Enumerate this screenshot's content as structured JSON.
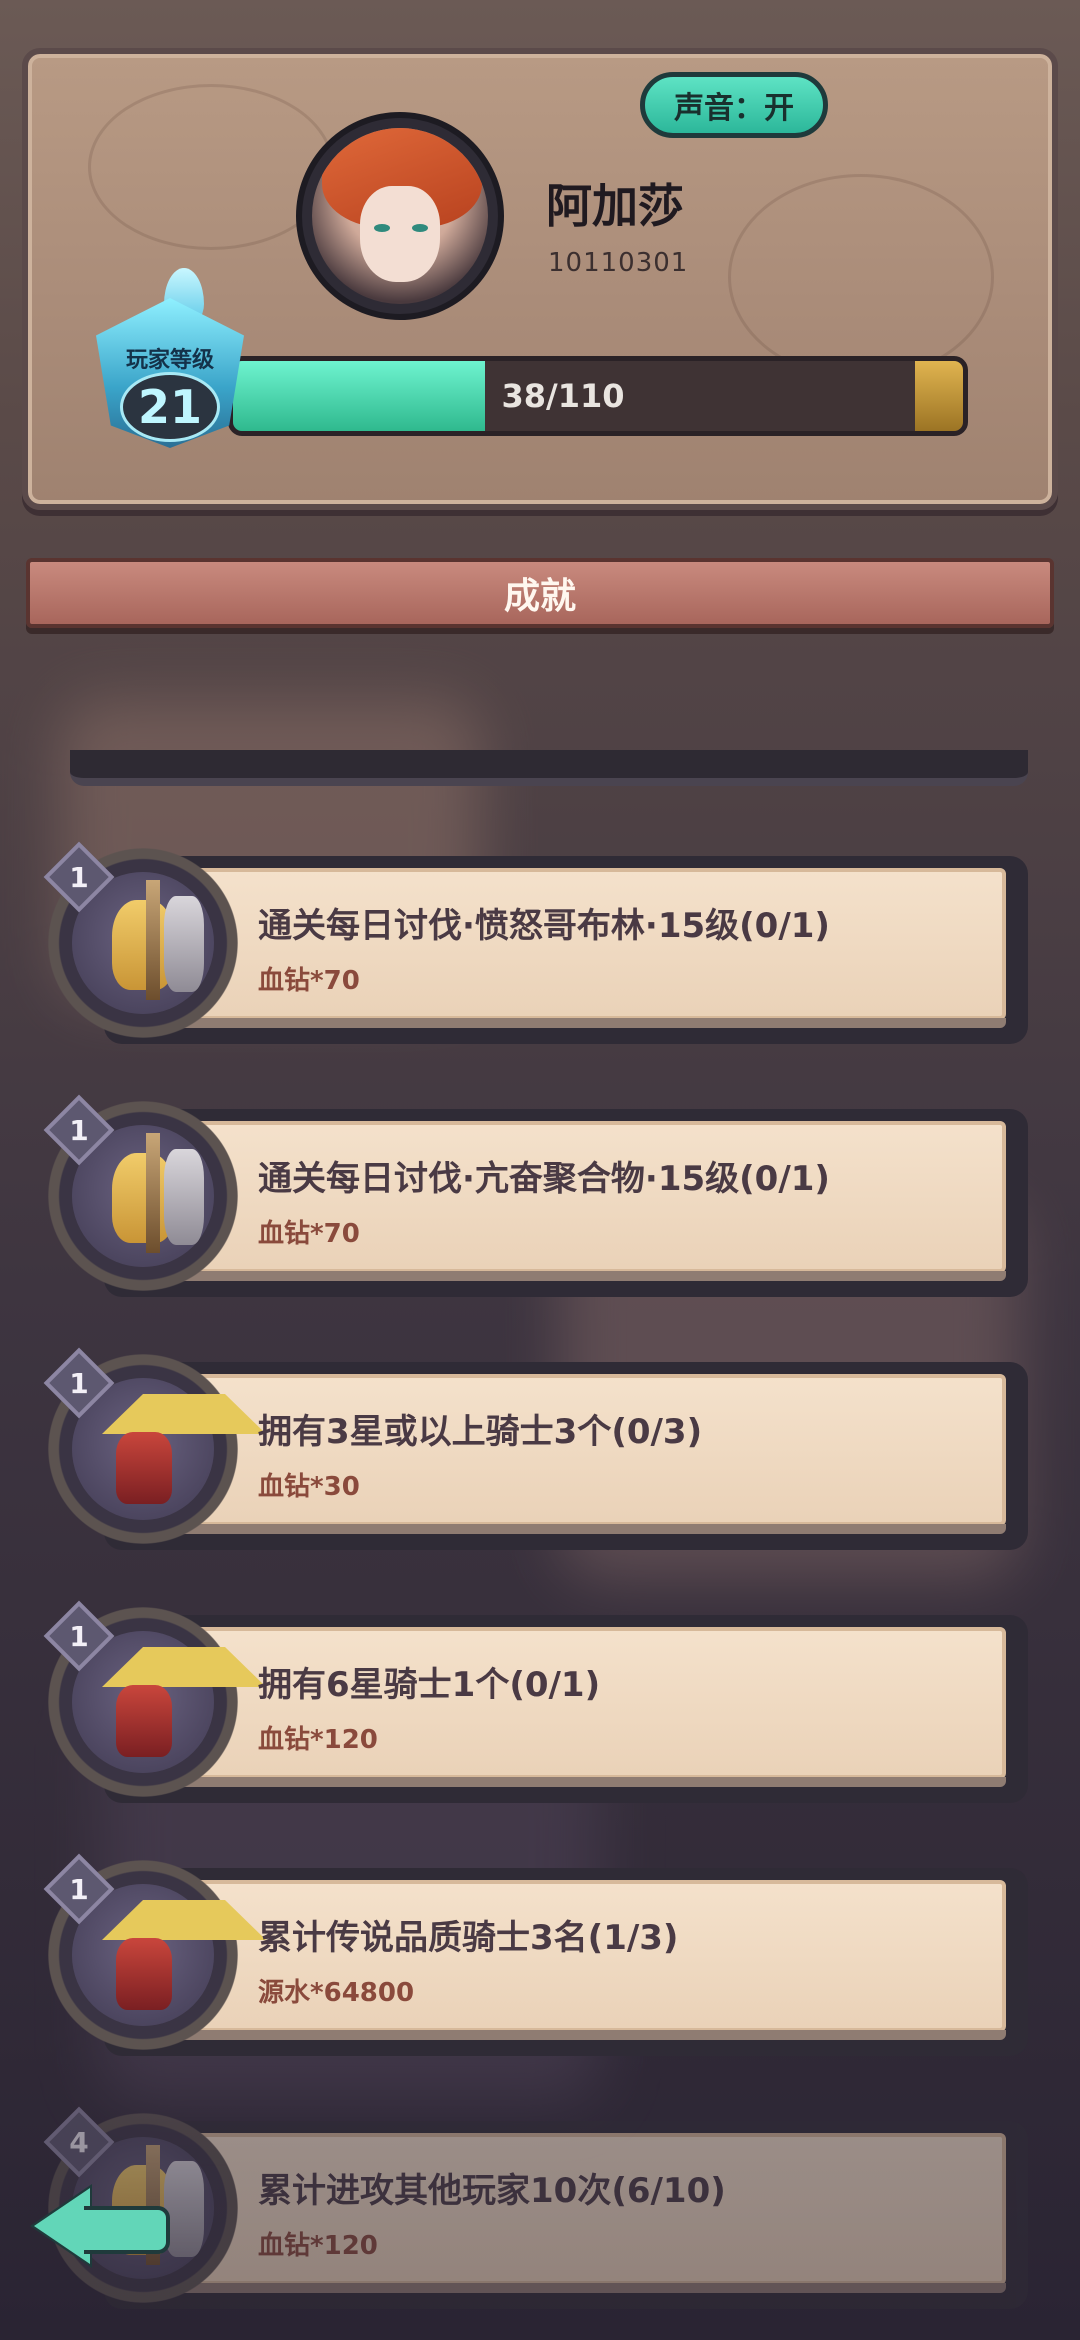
{
  "header": {
    "sound_button": "声音：开",
    "player_name": "阿加莎",
    "player_id": "10110301",
    "level_label": "玩家等级",
    "level": "21",
    "xp_text": "38/110",
    "xp_fraction": 0.345
  },
  "section": {
    "title": "成就"
  },
  "achievements": [
    {
      "rank": "1",
      "title": "通关每日讨伐·愤怒哥布林·15级(0/1)",
      "reward": "血钻*70",
      "icon": "goblin-duo-portrait-icon"
    },
    {
      "rank": "1",
      "title": "通关每日讨伐·亢奋聚合物·15级(0/1)",
      "reward": "血钻*70",
      "icon": "goblin-duo-portrait-icon"
    },
    {
      "rank": "1",
      "title": "拥有3星或以上骑士3个(0/3)",
      "reward": "血钻*30",
      "icon": "knight-portrait-icon"
    },
    {
      "rank": "1",
      "title": "拥有6星骑士1个(0/1)",
      "reward": "血钻*120",
      "icon": "knight-portrait-icon"
    },
    {
      "rank": "1",
      "title": "累计传说品质骑士3名(1/3)",
      "reward": "源水*64800",
      "icon": "knight-portrait-icon"
    },
    {
      "rank": "4",
      "title": "累计进攻其他玩家10次(6/10)",
      "reward": "血钻*120",
      "icon": "goblin-duo-portrait-icon"
    }
  ],
  "colors": {
    "accent_teal": "#5ee3c4",
    "card_bg": "#f4e1cb",
    "section_bar": "#c98a7e"
  }
}
